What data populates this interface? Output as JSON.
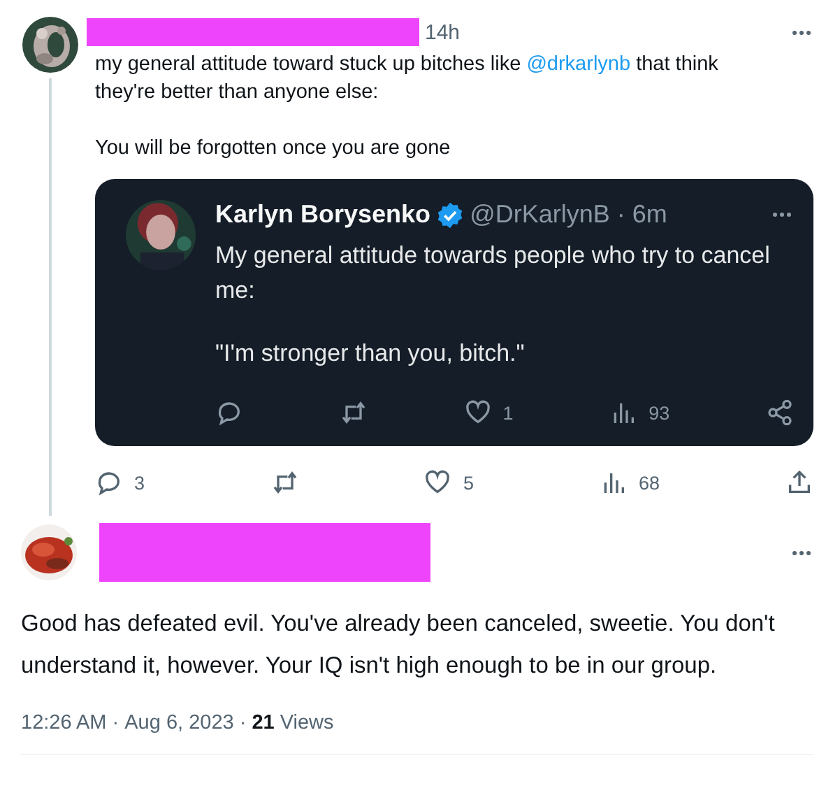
{
  "tweet": {
    "author_redacted": true,
    "time": "14h",
    "body": [
      [
        {
          "kind": "text",
          "text": "my general attitude toward stuck up bitches like "
        },
        {
          "kind": "mention",
          "text": "@drkarlynb"
        },
        {
          "kind": "text",
          "text": " that think they're better than anyone else:"
        }
      ],
      [
        {
          "kind": "text",
          "text": "You will be forgotten once you are gone"
        }
      ]
    ],
    "quoted": {
      "name": "Karlyn Borysenko",
      "verified": true,
      "handle": "@DrKarlynB",
      "time": "· 6m",
      "body": [
        "My general attitude towards people who try to cancel me:",
        "\"I'm stronger than you, bitch.\""
      ],
      "actions": [
        {
          "kind": "reply"
        },
        {
          "kind": "retweet"
        },
        {
          "kind": "like",
          "count": "1"
        },
        {
          "kind": "views",
          "count": "93"
        },
        {
          "kind": "share"
        }
      ]
    },
    "actions": [
      {
        "kind": "reply",
        "count": "3"
      },
      {
        "kind": "retweet"
      },
      {
        "kind": "like",
        "count": "5"
      },
      {
        "kind": "views",
        "count": "68"
      },
      {
        "kind": "upload"
      }
    ]
  },
  "reply": {
    "author_redacted": true,
    "body": "Good has defeated evil. You've already been canceled, sweetie. You don't understand it, however. Your IQ isn't high enough to be in our group.",
    "time": "12:26 AM ·",
    "date": "Aug 6, 2023 ·",
    "views_count": "21",
    "views_label": "Views"
  }
}
